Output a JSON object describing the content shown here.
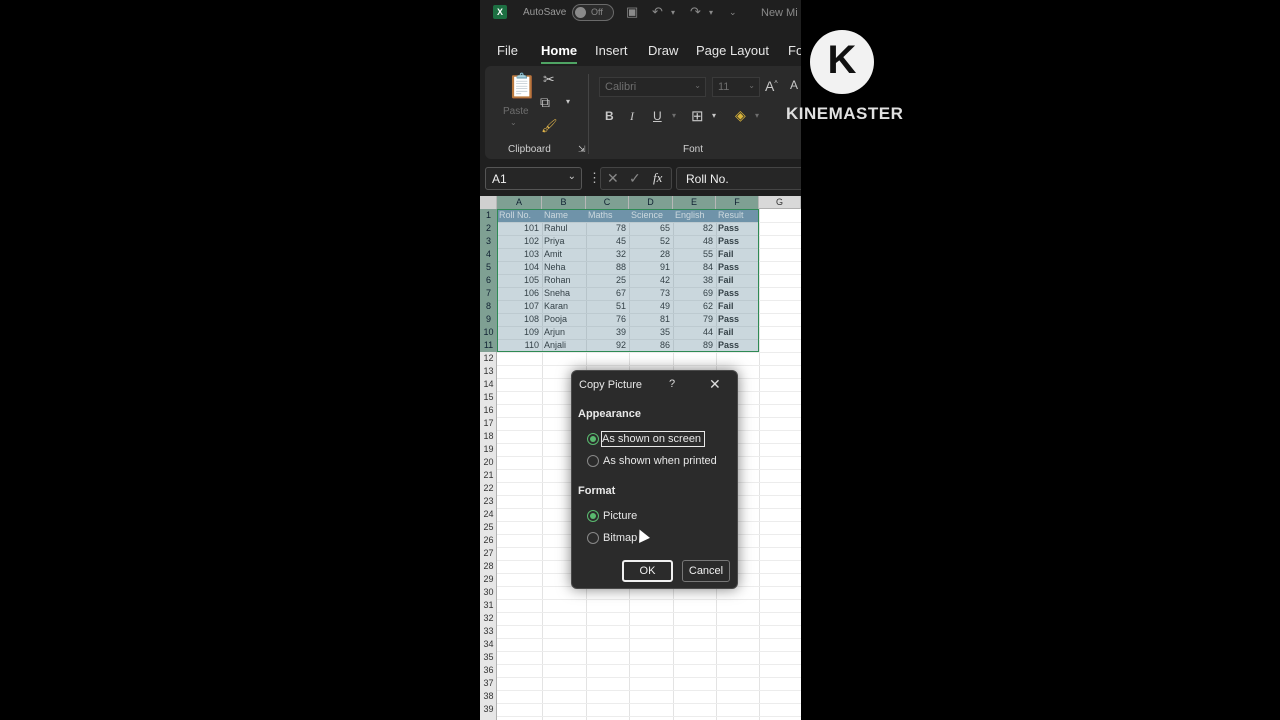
{
  "titlebar": {
    "autosave_label": "AutoSave",
    "autosave_state": "Off",
    "filename": "New Mi"
  },
  "ribbon_tabs": [
    "File",
    "Home",
    "Insert",
    "Draw",
    "Page Layout",
    "Fo"
  ],
  "ribbon": {
    "paste_label": "Paste",
    "clipboard_label": "Clipboard",
    "font_label": "Font",
    "font_name": "Calibri",
    "font_size": "11"
  },
  "formula_bar": {
    "name_box": "A1",
    "fx": "fx",
    "content": "Roll No."
  },
  "columns": [
    "A",
    "B",
    "C",
    "D",
    "E",
    "F",
    "G"
  ],
  "row_numbers": [
    "1",
    "2",
    "3",
    "4",
    "5",
    "6",
    "7",
    "8",
    "9",
    "10",
    "11",
    "12",
    "13",
    "14",
    "15",
    "16",
    "17",
    "18",
    "19",
    "20",
    "21",
    "22",
    "23",
    "24",
    "25",
    "26",
    "27",
    "28",
    "29",
    "30",
    "31",
    "32",
    "33",
    "34",
    "35",
    "36",
    "37",
    "38",
    "39"
  ],
  "table": {
    "headers": [
      "Roll No.",
      "Name",
      "Maths",
      "Science",
      "English",
      "Result"
    ],
    "rows": [
      [
        "101",
        "Rahul",
        "78",
        "65",
        "82",
        "Pass"
      ],
      [
        "102",
        "Priya",
        "45",
        "52",
        "48",
        "Pass"
      ],
      [
        "103",
        "Amit",
        "32",
        "28",
        "55",
        "Fail"
      ],
      [
        "104",
        "Neha",
        "88",
        "91",
        "84",
        "Pass"
      ],
      [
        "105",
        "Rohan",
        "25",
        "42",
        "38",
        "Fail"
      ],
      [
        "106",
        "Sneha",
        "67",
        "73",
        "69",
        "Pass"
      ],
      [
        "107",
        "Karan",
        "51",
        "49",
        "62",
        "Fail"
      ],
      [
        "108",
        "Pooja",
        "76",
        "81",
        "79",
        "Pass"
      ],
      [
        "109",
        "Arjun",
        "39",
        "35",
        "44",
        "Fail"
      ],
      [
        "110",
        "Anjali",
        "92",
        "86",
        "89",
        "Pass"
      ]
    ]
  },
  "dialog": {
    "title": "Copy Picture",
    "help": "?",
    "appearance_label": "Appearance",
    "appearance_options": [
      "As shown on screen",
      "As shown when printed"
    ],
    "appearance_selected": "As shown on screen",
    "format_label": "Format",
    "format_options": [
      "Picture",
      "Bitmap"
    ],
    "format_selected": "Picture",
    "ok_label": "OK",
    "cancel_label": "Cancel"
  },
  "watermark": {
    "logo_letter": "K",
    "text": "KINEMASTER"
  },
  "colors": {
    "selection_border": "#2e8a54",
    "header_fill": "#7a9bb3",
    "radio_accent": "#59b96f"
  }
}
